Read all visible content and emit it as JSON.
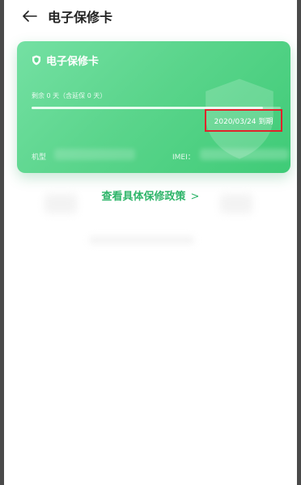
{
  "header": {
    "back_icon": "arrow-left-icon",
    "title": "电子保修卡"
  },
  "card": {
    "title": "电子保修卡",
    "title_icon": "shield-icon",
    "remaining": "剩余 0 天（含延保 0 天）",
    "progress": 0.93,
    "expiry": "2020/03/24 到期",
    "model_label": "机型",
    "imei_label": "IMEI："
  },
  "policy_link": {
    "label": "查看具体保修政策",
    "chevron": ">"
  },
  "colors": {
    "card_green": "#5bd58c",
    "link_green": "#2fb56a",
    "highlight_red": "#e0232b"
  }
}
